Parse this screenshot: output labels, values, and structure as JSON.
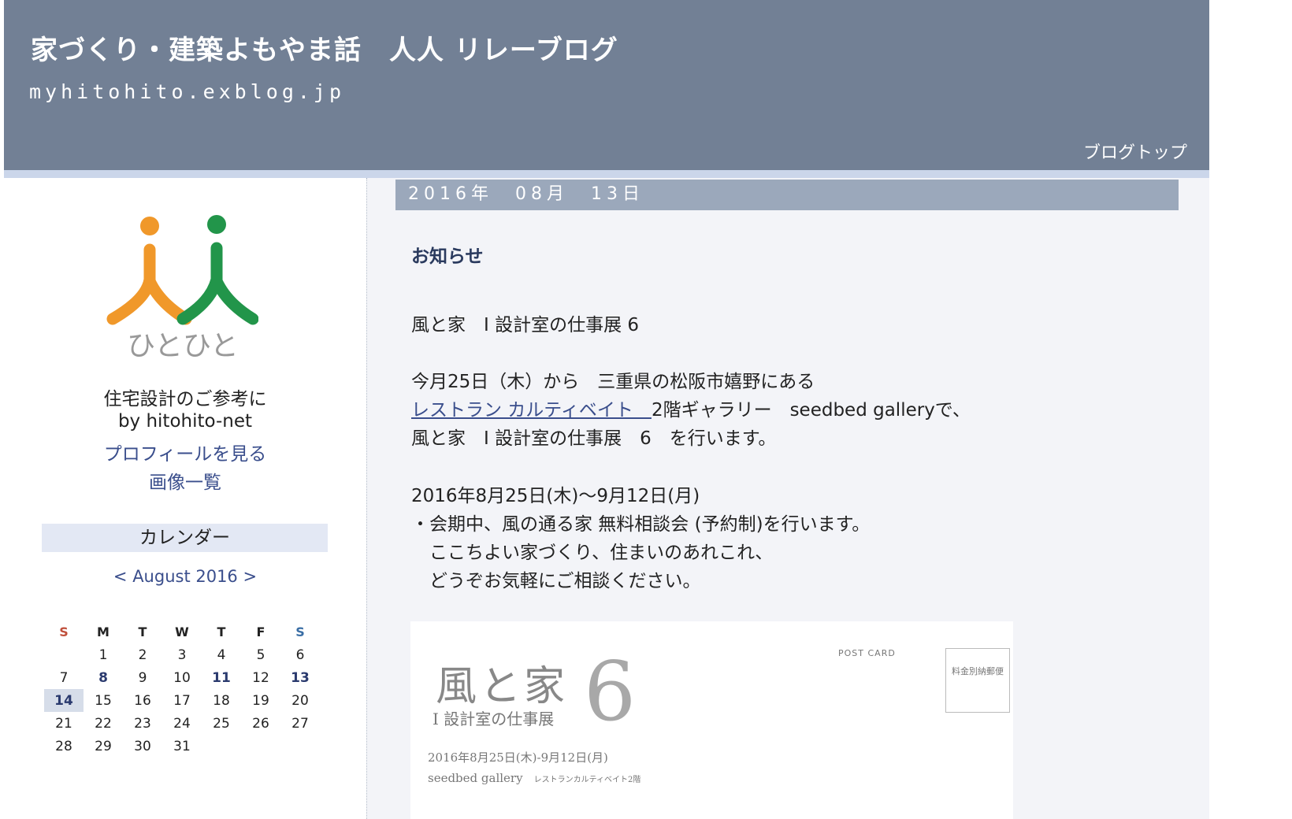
{
  "header": {
    "title": "家づくり・建築よもやま話　人人 リレーブログ",
    "url": "myhitohito.exblog.jp",
    "blog_top": "ブログトップ"
  },
  "sidebar": {
    "logo_text": "ひとひと",
    "profile_lines": [
      "住宅設計のご参考に",
      "by hitohito-net"
    ],
    "profile_link": "プロフィールを見る",
    "images_link": "画像一覧",
    "calendar": {
      "heading": "カレンダー",
      "prev": "<",
      "month": "August 2016",
      "next": ">",
      "weekdays": [
        "S",
        "M",
        "T",
        "W",
        "T",
        "F",
        "S"
      ],
      "weeks": [
        [
          "",
          "1",
          "2",
          "3",
          "4",
          "5",
          "6"
        ],
        [
          "7",
          "8",
          "9",
          "10",
          "11",
          "12",
          "13"
        ],
        [
          "14",
          "15",
          "16",
          "17",
          "18",
          "19",
          "20"
        ],
        [
          "21",
          "22",
          "23",
          "24",
          "25",
          "26",
          "27"
        ],
        [
          "28",
          "29",
          "30",
          "31",
          "",
          "",
          ""
        ]
      ],
      "post_days": [
        "8",
        "11",
        "13",
        "14"
      ],
      "today": "14"
    }
  },
  "post": {
    "date": "2016年　08月　13日",
    "title": "お知らせ",
    "line1": "風と家　I 設計室の仕事展 6",
    "line2": "今月25日（木）から　三重県の松阪市嬉野にある",
    "link_text": "レストラン カルティベイト　",
    "line3_rest": "2階ギャラリー　seedbed galleryで、",
    "line4": "風と家　I 設計室の仕事展　6　を行います。",
    "line5": "2016年8月25日(木)〜9月12日(月)",
    "line6": "・会期中、風の通る家 無料相談会 (予約制)を行います。",
    "line7": "　ここちよい家づくり、住まいのあれこれ、",
    "line8": "　どうぞお気軽にご相談ください。"
  },
  "postcard": {
    "title": "風と家",
    "number": "6",
    "subtitle": "I 設計室の仕事展",
    "label": "POST CARD",
    "stamp": "料金別納郵便",
    "dates": "2016年8月25日(木)-9月12日(月)",
    "venue": "seedbed gallery",
    "venue_note": "レストランカルティベイト2階"
  }
}
